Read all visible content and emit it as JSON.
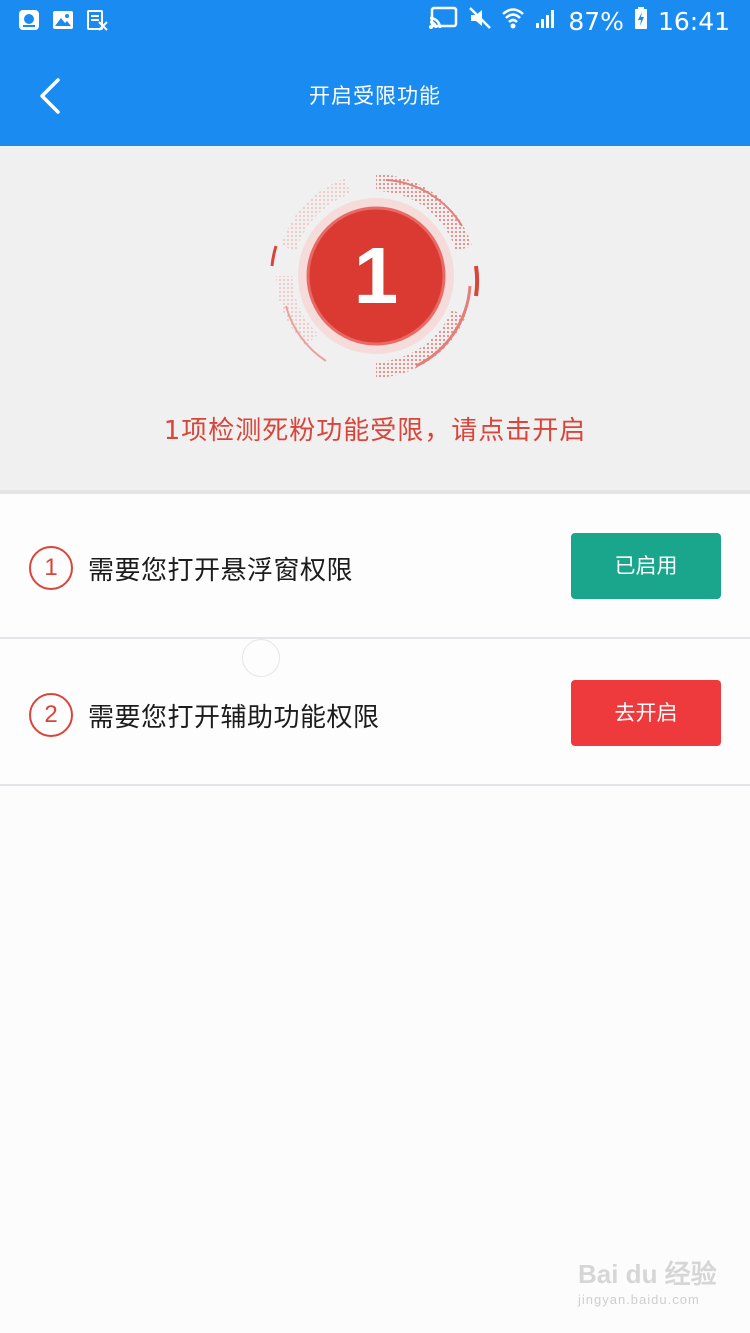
{
  "status_bar": {
    "battery": "87%",
    "time": "16:41"
  },
  "header": {
    "title": "开启受限功能",
    "back_icon": "chevron-left-icon"
  },
  "hero": {
    "count": "1",
    "message": "1项检测死粉功能受限，请点击开启",
    "accent_color": "#d9453a"
  },
  "permissions": [
    {
      "index": "1",
      "label": "需要您打开悬浮窗权限",
      "button_label": "已启用",
      "button_color": "#1aa68c"
    },
    {
      "index": "2",
      "label": "需要您打开辅助功能权限",
      "button_label": "去开启",
      "button_color": "#ee3a3d"
    }
  ],
  "colors": {
    "primary": "#1a8cf1",
    "hero_bg": "#f0f0f0"
  }
}
